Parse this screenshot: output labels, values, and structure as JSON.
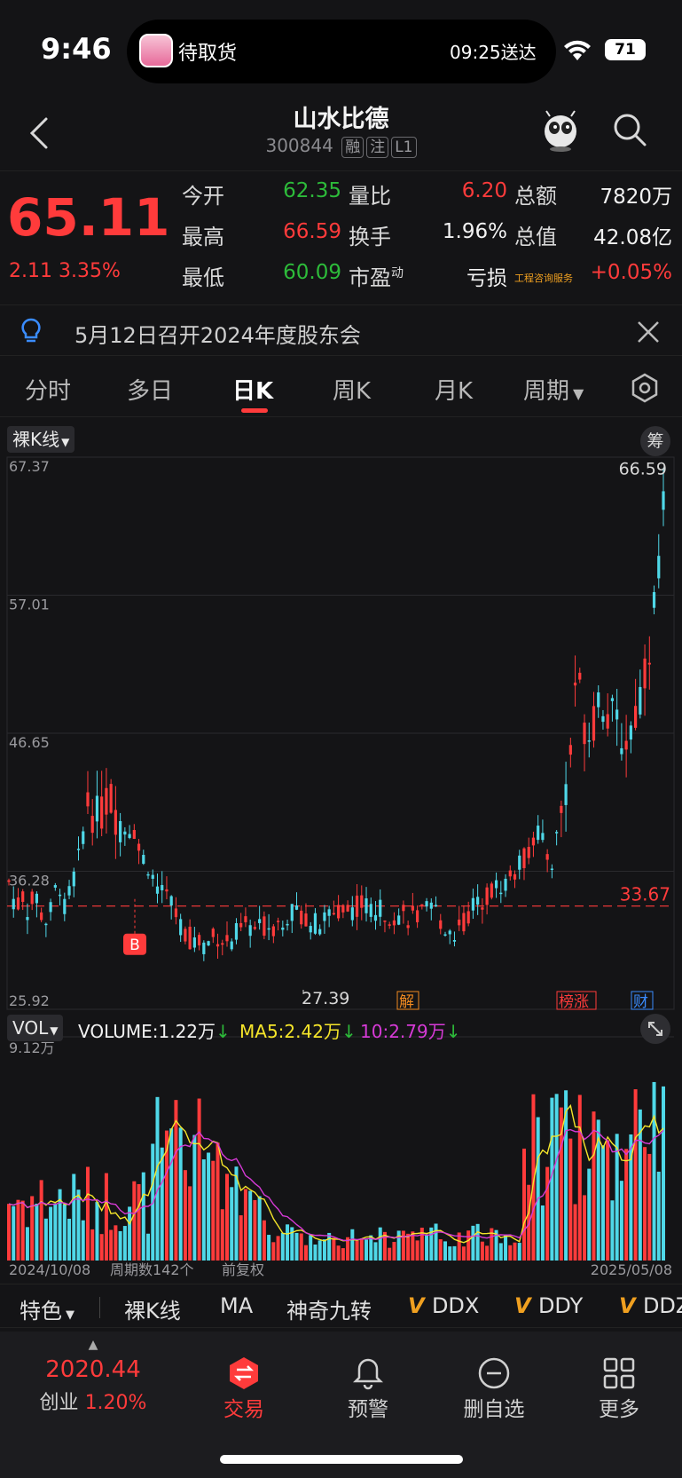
{
  "status_bar": {
    "time": "9:46",
    "island_label": "待取货",
    "island_time": "09:25送达",
    "battery": "71"
  },
  "header": {
    "stock_name": "山水比德",
    "stock_code": "300844",
    "tags": [
      "融",
      "注",
      "L1"
    ]
  },
  "quote": {
    "price": "65.11",
    "change": "2.11  3.35%",
    "rows": [
      {
        "l1": "今开",
        "v1": "62.35",
        "c1": "green",
        "l2": "量比",
        "v2": "6.20",
        "c2": "red",
        "l3": "总额",
        "v3": "7820万",
        "c3": "white"
      },
      {
        "l1": "最高",
        "v1": "66.59",
        "c1": "red",
        "l2": "换手",
        "v2": "1.96%",
        "c2": "white",
        "l3": "总值",
        "v3": "42.08亿",
        "c3": "white"
      },
      {
        "l1": "最低",
        "v1": "60.09",
        "c1": "green",
        "l2": "市盈",
        "v2": "亏损",
        "c2": "white",
        "l3": "工程咨询服务",
        "v3": "+0.05%",
        "c3": "red"
      }
    ],
    "pe_superscript": "动"
  },
  "notice": {
    "text": "5月12日召开2024年度股东会"
  },
  "tabs": [
    "分时",
    "多日",
    "日K",
    "周K",
    "月K",
    "周期"
  ],
  "active_tab": "日K",
  "chart": {
    "kline_label": "裸K线",
    "chip_label": "筹",
    "price_axis": [
      "67.37",
      "57.01",
      "46.65",
      "36.28",
      "25.92"
    ],
    "high_label": "66.59",
    "low_label": "27.39",
    "ref_line_label": "33.67",
    "buy_marker": "B",
    "event_tags": [
      "解",
      "榜涨",
      "财"
    ],
    "volume_select": "VOL",
    "volume_text": "VOLUME:1.22万",
    "ma5_text": "MA5:2.42万",
    "ma10_text": "10:2.79万",
    "volume_axis_max": "9.12万",
    "start_date": "2024/10/08",
    "period_count": "周期数142个",
    "adjust": "前复权",
    "end_date": "2025/05/08",
    "colors": {
      "up": "#ff3b3b",
      "down": "#4fd8e8",
      "ma5": "#f5e52a",
      "ma10": "#d63ad6"
    }
  },
  "chart_data": {
    "type": "candlestick",
    "y_range": [
      25.92,
      67.37
    ],
    "period_high": 66.59,
    "period_low": 27.39,
    "reference_price": 33.67,
    "x_range": [
      "2024/10/08",
      "2025/05/08"
    ],
    "volume_max": "9.12万",
    "latest": {
      "volume": "1.22万",
      "ma5": "2.42万",
      "ma10": "2.79万"
    }
  },
  "indicators": {
    "special": "特色",
    "items": [
      "裸K线",
      "MA",
      "神奇九转",
      "DDX",
      "DDY",
      "DDZ"
    ]
  },
  "bottom_nav": {
    "index_value": "2020.44",
    "index_name": "创业",
    "index_change": "1.20%",
    "items": [
      "交易",
      "预警",
      "删自选",
      "更多"
    ]
  }
}
